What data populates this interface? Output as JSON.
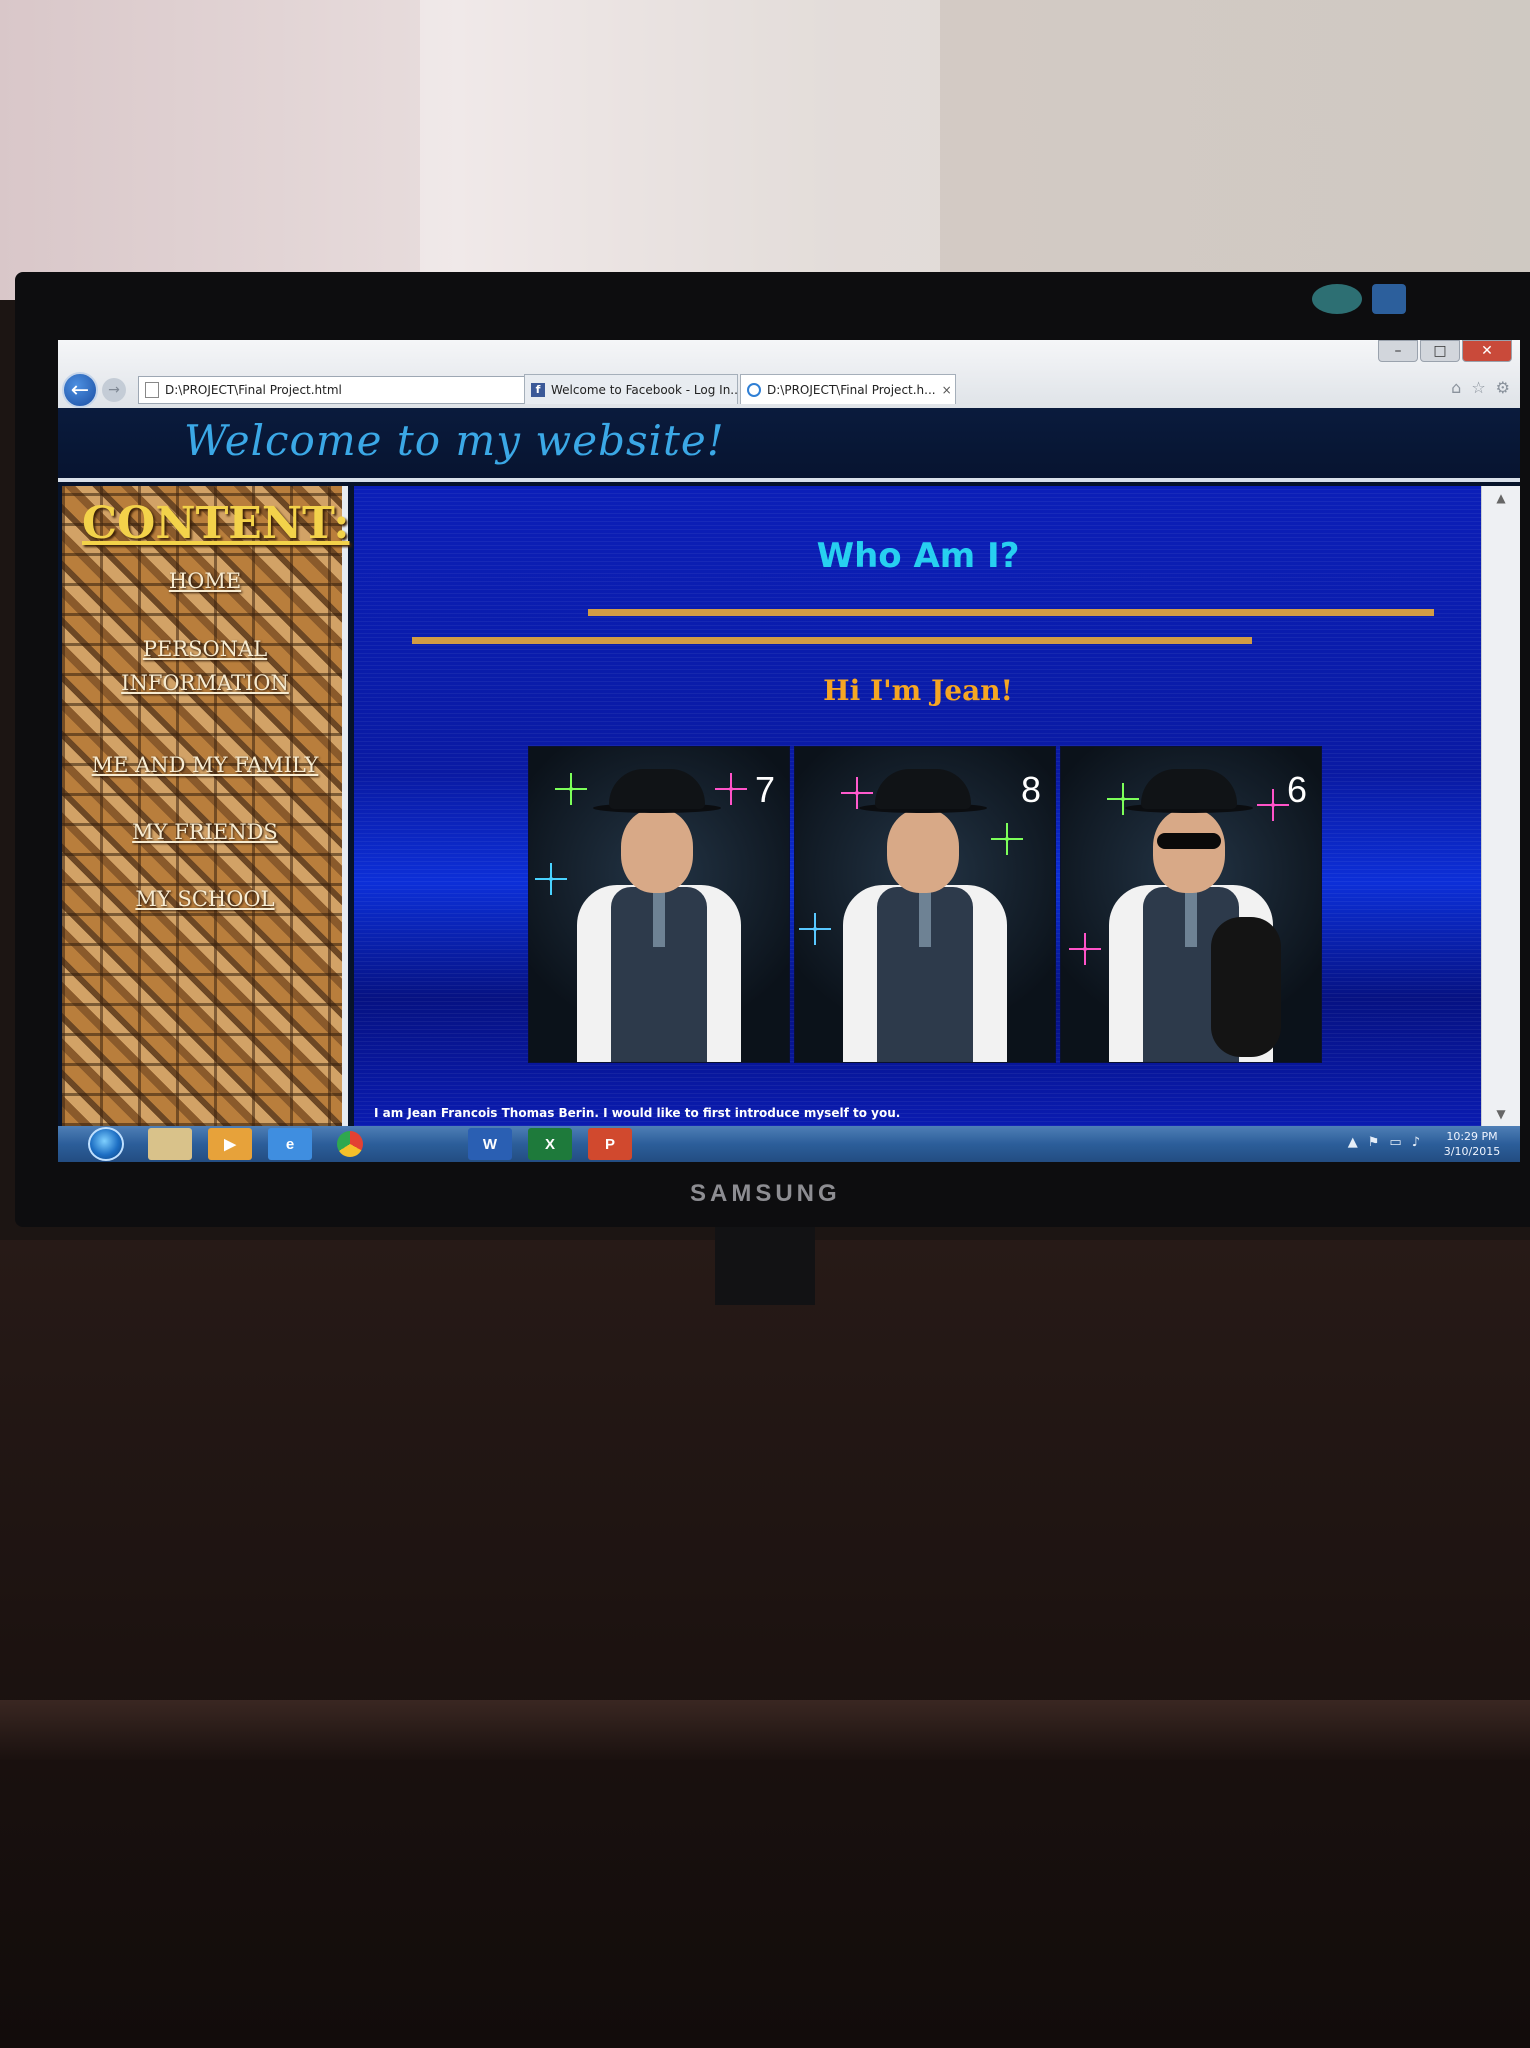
{
  "browser": {
    "address_url": "D:\\PROJECT\\Final Project.html",
    "tabs": [
      {
        "label": "Welcome to Facebook - Log In...",
        "icon": "facebook-icon"
      },
      {
        "label": "D:\\PROJECT\\Final Project.h...",
        "icon": "ie-icon"
      }
    ],
    "tab_close": "×",
    "window_buttons": {
      "minimize": "–",
      "maximize": "□",
      "close": "✕"
    }
  },
  "page": {
    "banner_title": "Welcome to my website!",
    "sidebar": {
      "heading": "CONTENT:",
      "nav": [
        "HOME",
        "PERSONAL INFORMATION",
        "ME AND MY FAMILY",
        "MY FRIENDS",
        "MY SCHOOL"
      ]
    },
    "main": {
      "heading": "Who Am I?",
      "subheading": "Hi I'm Jean!",
      "photos": [
        {
          "number": "7"
        },
        {
          "number": "8"
        },
        {
          "number": "6"
        }
      ],
      "intro": "I am Jean Francois Thomas Berin. I would like to first introduce myself to you."
    }
  },
  "taskbar": {
    "apps": [
      "start-orb",
      "explorer",
      "media-player",
      "internet-explorer",
      "chrome",
      "word",
      "excel",
      "powerpoint"
    ],
    "clock_time": "10:29 PM",
    "clock_date": "3/10/2015"
  },
  "monitor": {
    "brand": "SAMSUNG"
  },
  "colors": {
    "banner_text": "#3ba8e6",
    "sidebar_heading": "#f3d24a",
    "who_heading": "#27d0f0",
    "hi_text": "#f5a623",
    "rule": "#d29c45",
    "main_bg": "#0b1fb8"
  }
}
